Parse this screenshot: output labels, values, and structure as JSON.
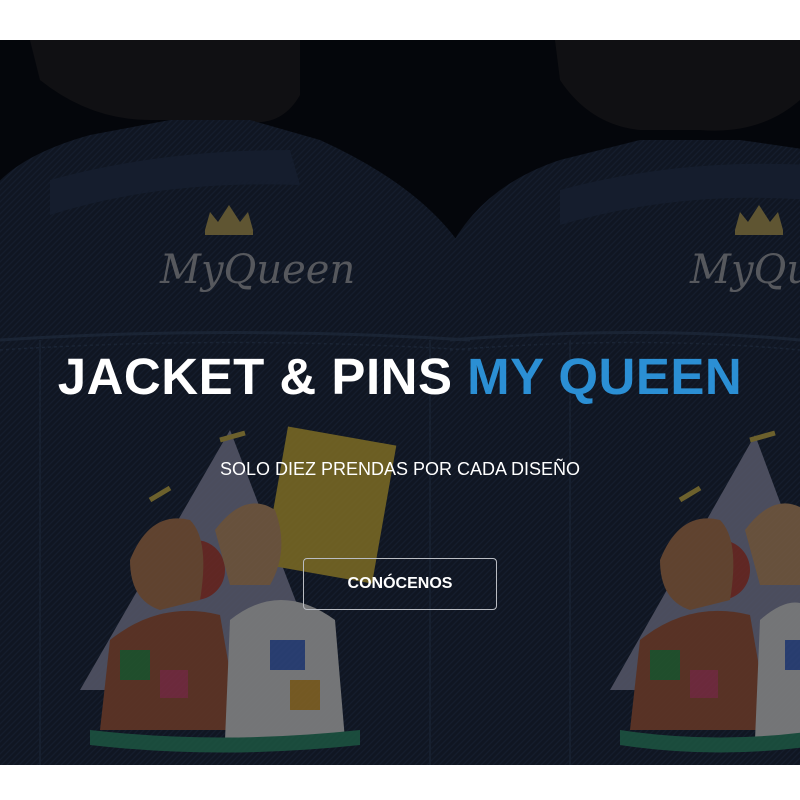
{
  "hero": {
    "headline_main": "JACKET & PINS",
    "headline_accent": "MY QUEEN",
    "subtitle": "SOLO DIEZ PRENDAS POR CADA DISEÑO",
    "cta_label": "CONÓCENOS",
    "accent_color": "#2b8fd4",
    "background_color": "#080b12"
  },
  "jacket_logo": {
    "text": "MyQueen",
    "icon": "crown-icon"
  }
}
